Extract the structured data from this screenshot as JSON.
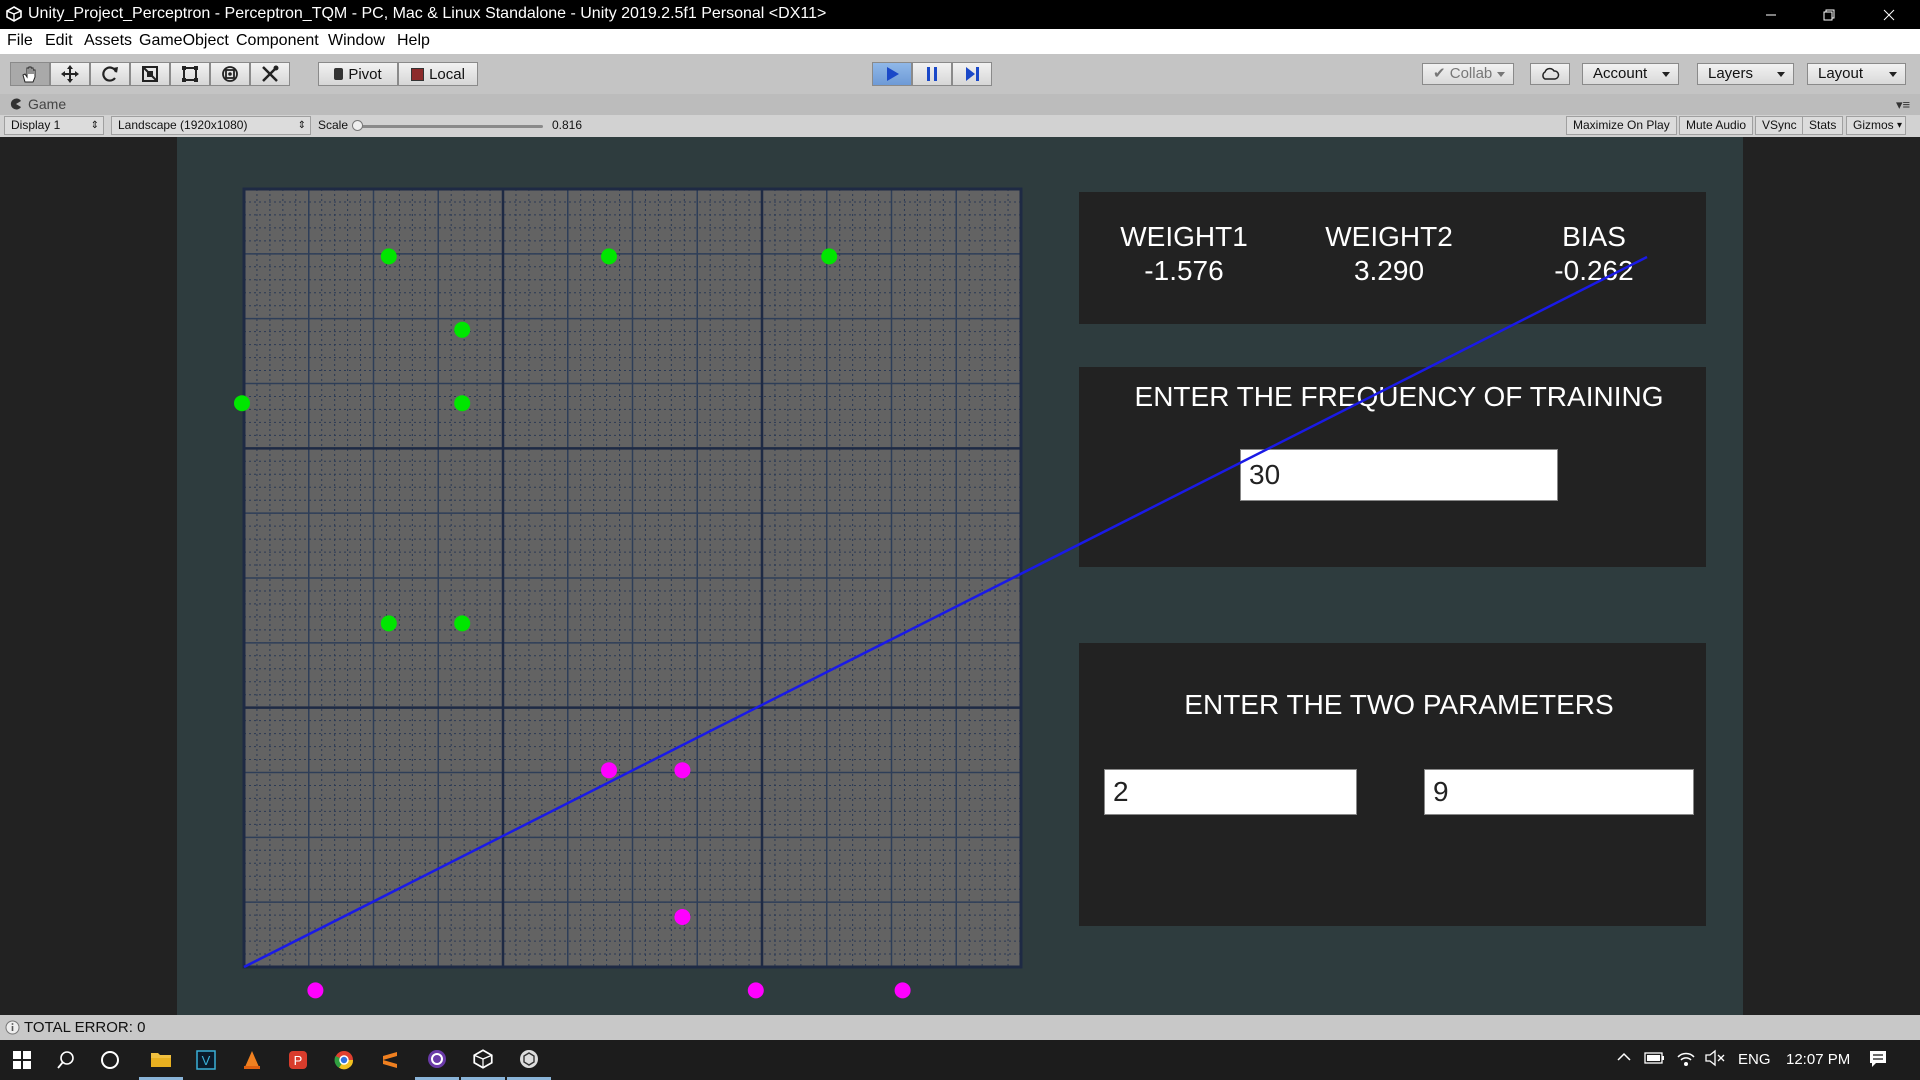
{
  "window": {
    "title": "Unity_Project_Perceptron - Perceptron_TQM - PC, Mac & Linux Standalone - Unity 2019.2.5f1 Personal <DX11>"
  },
  "menu": [
    "File",
    "Edit",
    "Assets",
    "GameObject",
    "Component",
    "Window",
    "Help"
  ],
  "toolbar": {
    "pivot_label": "Pivot",
    "local_label": "Local",
    "collab_label": "Collab",
    "account_label": "Account",
    "layers_label": "Layers",
    "layout_label": "Layout"
  },
  "game_tab": {
    "label": "Game"
  },
  "game_toolbar": {
    "display": "Display 1",
    "resolution": "Landscape (1920x1080)",
    "scale_label": "Scale",
    "scale_value": "0.816",
    "scale_fraction": 0.0,
    "maximize_label": "Maximize On Play",
    "mute_label": "Mute Audio",
    "vsync_label": "VSync",
    "stats_label": "Stats",
    "gizmos_label": "Gizmos"
  },
  "weights": {
    "weight1_label": "WEIGHT1",
    "weight1_value": "-1.576",
    "weight2_label": "WEIGHT2",
    "weight2_value": "3.290",
    "bias_label": "BIAS",
    "bias_value": "-0.262"
  },
  "frequency_panel": {
    "title": "ENTER THE FREQUENCY OF TRAINING",
    "value": "30"
  },
  "parameters_panel": {
    "title": "ENTER THE TWO PARAMETERS",
    "param1": "2",
    "param2": "9"
  },
  "plot": {
    "green_points": [
      [
        2,
        1
      ],
      [
        5,
        1
      ],
      [
        8,
        1
      ],
      [
        3,
        2
      ],
      [
        0,
        3
      ],
      [
        3,
        3
      ],
      [
        2,
        6
      ],
      [
        3,
        6
      ]
    ],
    "magenta_points": [
      [
        5,
        8
      ],
      [
        6,
        8
      ],
      [
        6,
        10
      ],
      [
        1,
        11
      ],
      [
        7,
        11
      ],
      [
        9,
        11
      ]
    ],
    "colors": {
      "green": "#00e600",
      "magenta": "#ff00ff",
      "line": "#1a1ae6"
    }
  },
  "status": {
    "text": "TOTAL ERROR: 0"
  },
  "taskbar": {
    "lang": "ENG",
    "time": "12:07 PM"
  }
}
